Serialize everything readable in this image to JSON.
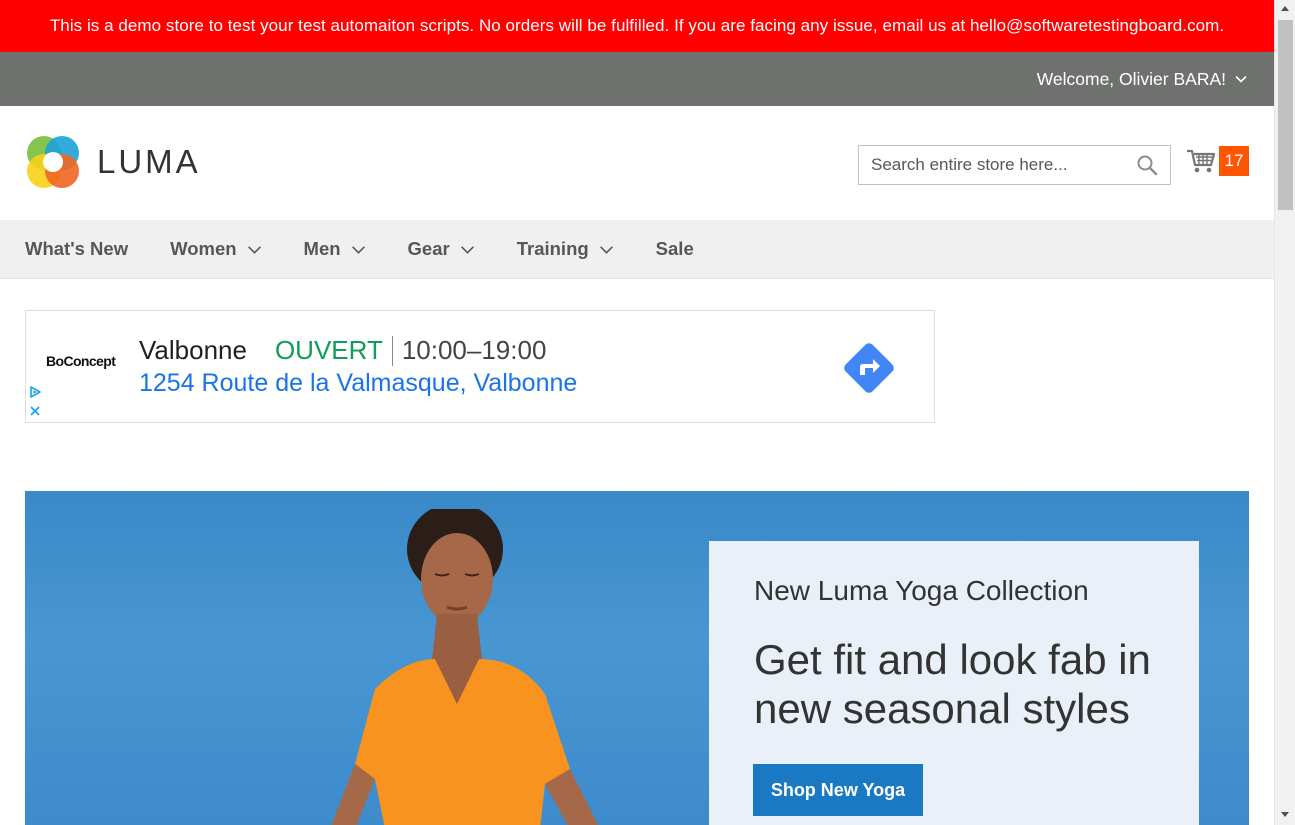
{
  "notice": {
    "text": "This is a demo store to test your test automaiton scripts. No orders will be fulfilled. If you are facing any issue, email us at hello@softwaretestingboard.com."
  },
  "panel": {
    "welcome": "Welcome, Olivier BARA!"
  },
  "header": {
    "logo_text": "LUMA",
    "search_placeholder": "Search entire store here...",
    "cart_count": "17"
  },
  "nav": {
    "items": [
      {
        "label": "What's New",
        "has_dropdown": false
      },
      {
        "label": "Women",
        "has_dropdown": true
      },
      {
        "label": "Men",
        "has_dropdown": true
      },
      {
        "label": "Gear",
        "has_dropdown": true
      },
      {
        "label": "Training",
        "has_dropdown": true
      },
      {
        "label": "Sale",
        "has_dropdown": false
      }
    ]
  },
  "ad": {
    "brand": "BoConcept",
    "city": "Valbonne",
    "status": "OUVERT",
    "hours": "10:00–19:00",
    "address": "1254 Route de la Valmasque, Valbonne"
  },
  "hero": {
    "kicker": "New Luma Yoga Collection",
    "title": "Get fit and look fab in new seasonal styles",
    "button": "Shop New Yoga"
  },
  "colors": {
    "notice_bg": "#ff0000",
    "panel_bg": "#6e716e",
    "nav_bg": "#f0f0f0",
    "cart_badge": "#ff5501",
    "primary_button": "#1979c3",
    "ad_open": "#0f9d58",
    "ad_link": "#1a73e8"
  },
  "icons": [
    "chevron-down-icon",
    "luma-logo-icon",
    "search-icon",
    "cart-icon",
    "adchoices-icon",
    "close-icon",
    "directions-icon"
  ]
}
